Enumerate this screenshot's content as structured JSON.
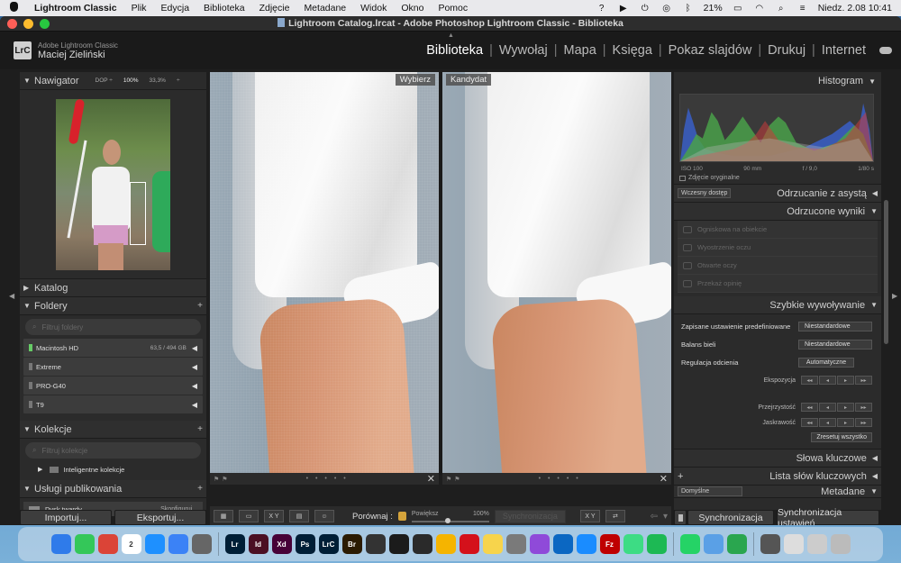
{
  "menubar": {
    "app": "Lightroom Classic",
    "items": [
      "Plik",
      "Edycja",
      "Biblioteka",
      "Zdjęcie",
      "Metadane",
      "Widok",
      "Okno",
      "Pomoc"
    ],
    "battery": "21%",
    "clock": "Niedz. 2.08  10:41"
  },
  "window": {
    "title": "Lightroom Catalog.lrcat - Adobe Photoshop Lightroom Classic - Biblioteka"
  },
  "identity": {
    "logo": "LrC",
    "product": "Adobe Lightroom Classic",
    "user": "Maciej  Zieliński"
  },
  "modules": {
    "items": [
      "Biblioteka",
      "Wywołaj",
      "Mapa",
      "Księga",
      "Pokaz slajdów",
      "Drukuj",
      "Internet"
    ],
    "active": "Biblioteka"
  },
  "left_panel": {
    "navigator": {
      "title": "Nawigator",
      "zoom": [
        "DOP ÷",
        "100%",
        "33,3%",
        "÷"
      ]
    },
    "catalog": {
      "title": "Katalog"
    },
    "folders": {
      "title": "Foldery",
      "add": "+",
      "search_placeholder": "Filtruj foldery",
      "items": [
        {
          "name": "Macintosh HD",
          "size": "63,5 / 494 GB"
        },
        {
          "name": "Extreme",
          "size": ""
        },
        {
          "name": "PRO-G40",
          "size": ""
        },
        {
          "name": "T9",
          "size": ""
        }
      ]
    },
    "collections": {
      "title": "Kolekcje",
      "add": "+",
      "search_placeholder": "Filtruj kolekcje",
      "items": [
        "Inteligentne kolekcje"
      ]
    },
    "publish": {
      "title": "Usługi publikowania",
      "add": "+",
      "items": [
        {
          "name": "Dysk twardy",
          "action": "Skonfiguruj..."
        }
      ]
    },
    "import_label": "Importuj...",
    "export_label": "Eksportuj..."
  },
  "compare": {
    "left_label": "Wybierz",
    "right_label": "Kandydat",
    "strip_dots": "• • • • •",
    "close": "✕"
  },
  "toolbar": {
    "compare_label": "Porównaj :",
    "zoom_label": "Powiększ",
    "zoom_value": "100%",
    "zoom_fraction": 0.47,
    "sync_label": "Synchronizacja",
    "xy1": "X Y",
    "xy2": "X Y"
  },
  "right_panel": {
    "histogram": {
      "title": "Histogram",
      "iso": "ISO 100",
      "focal": "90 mm",
      "aperture": "f / 9,0",
      "shutter": "1/80 s",
      "original": "Zdjęcie oryginalne"
    },
    "assisted_culling": {
      "title": "Odrzucanie z asystą",
      "early_access": "Wczesny dostęp"
    },
    "rejected": {
      "title": "Odrzucone wyniki",
      "items": [
        "Ogniskowa na obiekcie",
        "Wyostrzenie oczu",
        "Otwarte oczy",
        "Przekaż opinię"
      ]
    },
    "quick_develop": {
      "title": "Szybkie wywoływanie",
      "preset_label": "Zapisane ustawienie predefiniowane",
      "preset_value": "Niestandardowe",
      "wb_label": "Balans bieli",
      "wb_value": "Niestandardowe",
      "tone_label": "Regulacja odcienia",
      "tone_value": "Automatyczne",
      "exposure": "Ekspozycja",
      "clarity": "Przejrzystość",
      "vibrance": "Jaskrawość",
      "reset": "Zresetuj wszystko",
      "step_lt": "◂◂",
      "step_l": "◂",
      "step_r": "▸",
      "step_rt": "▸▸"
    },
    "keywording": {
      "title": "Słowa kluczowe"
    },
    "keyword_list": {
      "title": "Lista słów kluczowych",
      "add": "+"
    },
    "metadata": {
      "title": "Metadane",
      "preset": "Domyślne"
    },
    "sync_label": "Synchronizacja",
    "sync_settings_label": "Synchronizacja ustawień"
  },
  "dock": {
    "apps": [
      "Finder",
      "Wiadomości",
      "Chrome",
      "Kalendarz",
      "Safari",
      "Mail",
      "Kalkulator",
      "Lr",
      "Id",
      "Xd",
      "Ps",
      "LrC",
      "Br",
      "Podgląd",
      "Fresco",
      "DaVinci",
      "Zdjęcia",
      "Acrobat",
      "Notatki",
      "Ustawienia",
      "Podcasty",
      "Pasek",
      "App Store",
      "FileZilla",
      "Android Studio",
      "Spotify",
      "WhatsApp",
      "Skaner",
      "Numbers",
      "Zrzuty",
      "Pulpit",
      "Okna",
      "Kosz"
    ],
    "calendar_day": "2"
  }
}
